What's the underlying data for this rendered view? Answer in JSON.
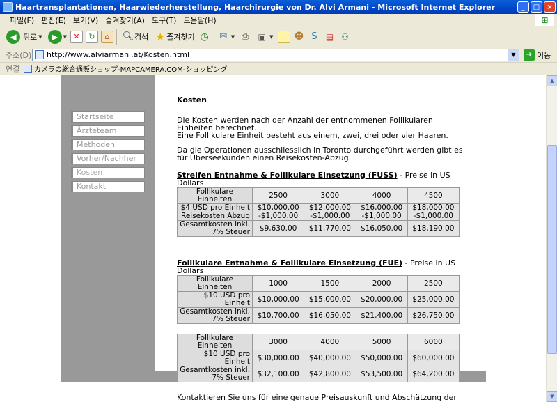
{
  "window": {
    "title": "Haartransplantationen, Haarwiederherstellung, Haarchirurgie von Dr. Alvi Armani - Microsoft Internet Explorer",
    "min_label": "_",
    "max_label": "□",
    "close_label": "×"
  },
  "menu": [
    "파일(F)",
    "편집(E)",
    "보기(V)",
    "즐겨찾기(A)",
    "도구(T)",
    "도움말(H)"
  ],
  "toolbar": {
    "back_label": "뒤로",
    "search_label": "검색",
    "favorites_label": "즐겨찾기"
  },
  "address": {
    "label": "주소(D)",
    "url": "http://www.alviarmani.at/Kosten.html",
    "go_label": "이동"
  },
  "links": {
    "label": "연결",
    "item": "カメラの総合通販ショップ-MAPCAMERA.COM-ショッピング"
  },
  "nav": [
    "Startseite",
    "Ärzteteam",
    "Methoden",
    "Vorher/Nachher",
    "Kosten",
    "Kontakt"
  ],
  "content": {
    "heading": "Kosten",
    "intro_1": "Die Kosten werden nach der Anzahl der entnommenen Follikularen Einheiten berechnet.",
    "intro_2": "Eine Follikulare Einheit besteht aus einem, zwei, drei oder vier Haaren.",
    "intro_3": "Da die Operationen ausschliesslich in Toronto durchgeführt werden gibt es für Überseekunden einen Reisekosten-Abzug.",
    "fuss_title": "Streifen Entnahme & Follikulare Einsetzung (FUSS)",
    "fuss_suffix": " - Preise in US Dollars",
    "fue_title": "Follikulare Entnahme & Follikulare Einsetzung (FUE)",
    "fue_suffix": " - Preise in US Dollars",
    "contact": "Kontaktieren Sie uns für eine genaue Preisauskunft und Abschätzung der benötigten Einheiten."
  },
  "tables": {
    "fuss": {
      "rows": [
        [
          "Follikulare Einheiten",
          "2500",
          "3000",
          "4000",
          "4500"
        ],
        [
          "$4 USD pro Einheit",
          "$10,000.00",
          "$12,000.00",
          "$16,000.00",
          "$18,000.00"
        ],
        [
          "Reisekosten Abzug",
          "-$1,000.00",
          "-$1,000.00",
          "-$1,000.00",
          "-$1,000.00"
        ],
        [
          "Gesamtkosten inkl. 7% Steuer",
          "$9,630.00",
          "$11,770.00",
          "$16,050.00",
          "$18,190.00"
        ]
      ]
    },
    "fue1": {
      "rows": [
        [
          "Follikulare Einheiten",
          "1000",
          "1500",
          "2000",
          "2500"
        ],
        [
          "$10 USD pro Einheit",
          "$10,000.00",
          "$15,000.00",
          "$20,000.00",
          "$25,000.00"
        ],
        [
          "Gesamtkosten inkl. 7% Steuer",
          "$10,700.00",
          "$16,050.00",
          "$21,400.00",
          "$26,750.00"
        ]
      ]
    },
    "fue2": {
      "rows": [
        [
          "Follikulare Einheiten",
          "3000",
          "4000",
          "5000",
          "6000"
        ],
        [
          "$10 USD pro Einheit",
          "$30,000.00",
          "$40,000.00",
          "$50,000.00",
          "$60,000.00"
        ],
        [
          "Gesamtkosten inkl. 7% Steuer",
          "$32,100.00",
          "$42,800.00",
          "$53,500.00",
          "$64,200.00"
        ]
      ]
    }
  }
}
